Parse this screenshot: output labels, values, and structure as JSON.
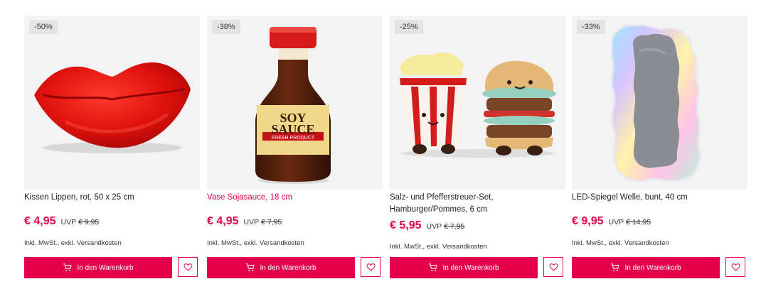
{
  "colors": {
    "accent": "#e4004b",
    "badge_bg": "#e4e4e4",
    "image_bg": "#f3f3f3"
  },
  "products": [
    {
      "discount": "-50%",
      "title": "Kissen Lippen, rot, 50 x 25 cm",
      "price": "€ 4,95",
      "uvp_label": "UVP",
      "old_price": "€ 9,95",
      "vat_note": "Inkl. MwSt., exkl. Versandkosten",
      "cart_label": "In den Warenkorb",
      "cart_icon": "cart-icon",
      "wish_icon": "heart-icon"
    },
    {
      "discount": "-38%",
      "title": "Vase Sojasauce, 18 cm",
      "price": "€ 4,95",
      "uvp_label": "UVP",
      "old_price": "€ 7,95",
      "vat_note": "Inkl. MwSt., exkl. Versandkosten",
      "cart_label": "In den Warenkorb",
      "cart_icon": "cart-icon",
      "wish_icon": "heart-icon",
      "image_text": {
        "line1": "SOY",
        "line2": "SAUCE",
        "line3": "FRESH PRODUCT"
      }
    },
    {
      "discount": "-25%",
      "title": "Salz- und Pfefferstreuer-Set, Hamburger/Pommes, 6 cm",
      "price": "€ 5,95",
      "uvp_label": "UVP",
      "old_price": "€ 7,95",
      "vat_note": "Inkl. MwSt., exkl. Versandkosten",
      "cart_label": "In den Warenkorb",
      "cart_icon": "cart-icon",
      "wish_icon": "heart-icon"
    },
    {
      "discount": "-33%",
      "title": "LED-Spiegel Welle, bunt, 40 cm",
      "price": "€ 9,95",
      "uvp_label": "UVP",
      "old_price": "€ 14,95",
      "vat_note": "Inkl. MwSt., exkl. Versandkosten",
      "cart_label": "In den Warenkorb",
      "cart_icon": "cart-icon",
      "wish_icon": "heart-icon"
    }
  ]
}
